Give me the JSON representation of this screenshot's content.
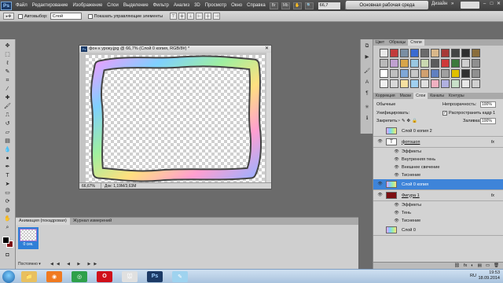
{
  "app": {
    "logo": "Ps",
    "menu": [
      "Файл",
      "Редактирование",
      "Изображение",
      "Слои",
      "Выделение",
      "Фильтр",
      "Анализ",
      "3D",
      "Просмотр",
      "Окно",
      "Справка"
    ],
    "zoom": "66,7",
    "workspace": "Основная рабочая среда",
    "workspace_alt": "Дизайн",
    "workspace_more": "»",
    "window_controls": [
      "–",
      "□",
      "✕"
    ]
  },
  "options": {
    "autoselect_label": "Автовыбор:",
    "autoselect_value": "Слой",
    "show_controls_label": "Показать управляющие элементы"
  },
  "document": {
    "title": "фон к уроку.jpg @ 66,7% (Слой 0 копия, RGB/8#) *",
    "zoom": "66,67%",
    "info": "Док: 1,19M/3,63M",
    "close": "✕"
  },
  "animation": {
    "tabs": [
      "Анимация (покадровая)",
      "Журнал измерений"
    ],
    "frame_time": "0 сек.",
    "loop": "Постоянно ▾",
    "controls": "◀◀ ◀ ▶ ▶▶"
  },
  "swatches_panel": {
    "tabs": [
      "Цвет",
      "Образцы",
      "Стили"
    ],
    "active_tab": "Стили",
    "styles": [
      "#e9e9e9",
      "#c23b3b",
      "#7a8ea3",
      "#3a6bd1",
      "#6b6b6b",
      "#d9b78a",
      "#a73a37",
      "#444444",
      "#2e2e2e",
      "#8a6d3b",
      "#b9b9b9",
      "#c0a0d0",
      "#d7a54a",
      "#99c7e0",
      "#c9d8b0",
      "#5c5c5c",
      "#cf3a3a",
      "#3c7a3c",
      "#cfcfcf",
      "#8f8f8f",
      "#ffffff",
      "#bfbfbf",
      "#7fa7d7",
      "#c7c7c7",
      "#d0a070",
      "#6080c0",
      "#a0a0a0",
      "#e0c000",
      "#303030",
      "#909090",
      "#f0f0f0",
      "#d8d8d8",
      "#f5e0a0",
      "#9fd0f0",
      "#e0e0e0",
      "#f0b0c0",
      "#b0b0e0",
      "#c8e0c8",
      "#e8e8e8",
      "#d0d0d0"
    ]
  },
  "layers_panel": {
    "tabs": [
      "Коррекция",
      "Маски",
      "Слои",
      "Каналы",
      "Контуры"
    ],
    "active_tab": "Слои",
    "blend_mode": "Обычные",
    "opacity_label": "Непрозрачность:",
    "opacity_value": "100%",
    "unify_label": "Унифицировать:",
    "propagate_label": "Распространить кадр 1",
    "lock_label": "Закрепить:",
    "fill_label": "Заливка:",
    "fill_value": "100%",
    "fx_badge": "fx",
    "rows": [
      {
        "kind": "layer",
        "name": "Слой 0 копия 2",
        "thumb": "rainbow",
        "fx": false,
        "selected": false,
        "visible": false
      },
      {
        "kind": "layer",
        "name": "фотошоп",
        "thumb": "text",
        "fx": true,
        "selected": false,
        "visible": true
      },
      {
        "kind": "effect",
        "name": "Эффекты"
      },
      {
        "kind": "effect",
        "name": "Внутренняя тень"
      },
      {
        "kind": "effect",
        "name": "Внешнее свечение"
      },
      {
        "kind": "effect",
        "name": "Тиснение"
      },
      {
        "kind": "layer",
        "name": "Слой 0 копия",
        "thumb": "rainbow",
        "fx": false,
        "selected": true,
        "visible": true
      },
      {
        "kind": "layer",
        "name": "Фигура 1",
        "thumb": "shape",
        "fx": true,
        "selected": false,
        "visible": true
      },
      {
        "kind": "effect",
        "name": "Эффекты"
      },
      {
        "kind": "effect",
        "name": "Тень"
      },
      {
        "kind": "effect",
        "name": "Тиснение"
      },
      {
        "kind": "layer",
        "name": "Слой 0",
        "thumb": "rainbow",
        "fx": false,
        "selected": false,
        "visible": false
      }
    ],
    "bottom_icons": [
      "⛓",
      "fx",
      "◐",
      "▤",
      "▭",
      "🗑"
    ]
  },
  "colors": {
    "foreground": "#000000",
    "background": "#7d0f12",
    "selection": "#3e84d9",
    "accent": "#2f7fd7"
  },
  "taskbar": {
    "lang": "RU",
    "time": "19:53",
    "date": "18.09.2014",
    "apps": [
      {
        "label": "📁",
        "bg": "#e8c060"
      },
      {
        "label": "◉",
        "bg": "#f07a20"
      },
      {
        "label": "◎",
        "bg": "#2ea04a"
      },
      {
        "label": "O",
        "bg": "#d0101a"
      },
      {
        "label": "🐭",
        "bg": "#e0e0e0"
      },
      {
        "label": "Ps",
        "bg": "#1c3a66"
      },
      {
        "label": "✎",
        "bg": "#9fd3ef"
      }
    ]
  }
}
